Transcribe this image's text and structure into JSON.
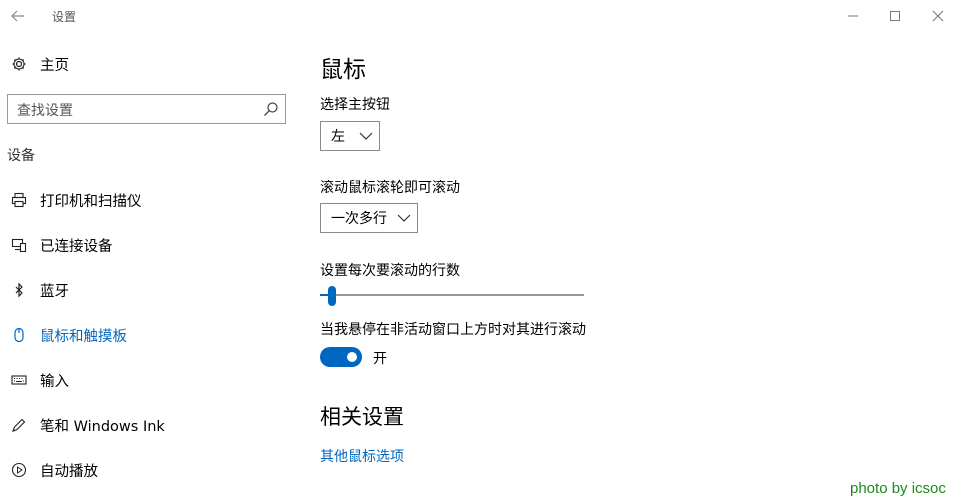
{
  "window": {
    "title": "设置"
  },
  "sidebar": {
    "home_label": "主页",
    "search_placeholder": "查找设置",
    "category": "设备",
    "items": [
      {
        "label": "打印机和扫描仪",
        "icon": "printer-icon"
      },
      {
        "label": "已连接设备",
        "icon": "connected-devices-icon"
      },
      {
        "label": "蓝牙",
        "icon": "bluetooth-icon"
      },
      {
        "label": "鼠标和触摸板",
        "icon": "mouse-icon",
        "active": true
      },
      {
        "label": "输入",
        "icon": "keyboard-icon"
      },
      {
        "label": "笔和 Windows Ink",
        "icon": "pen-icon"
      },
      {
        "label": "自动播放",
        "icon": "autoplay-icon"
      }
    ]
  },
  "main": {
    "title": "鼠标",
    "primary_button": {
      "label": "选择主按钮",
      "value": "左"
    },
    "wheel_scroll": {
      "label": "滚动鼠标滚轮即可滚动",
      "value": "一次多行"
    },
    "lines_to_scroll": {
      "label": "设置每次要滚动的行数",
      "value_fraction": 0.03
    },
    "inactive_scroll": {
      "label": "当我悬停在非活动窗口上方时对其进行滚动",
      "state": "开"
    },
    "related": {
      "title": "相关设置",
      "link": "其他鼠标选项"
    }
  },
  "watermark": "photo by icsoc",
  "colors": {
    "accent": "#0067c0",
    "watermark": "#1a8a1a"
  }
}
